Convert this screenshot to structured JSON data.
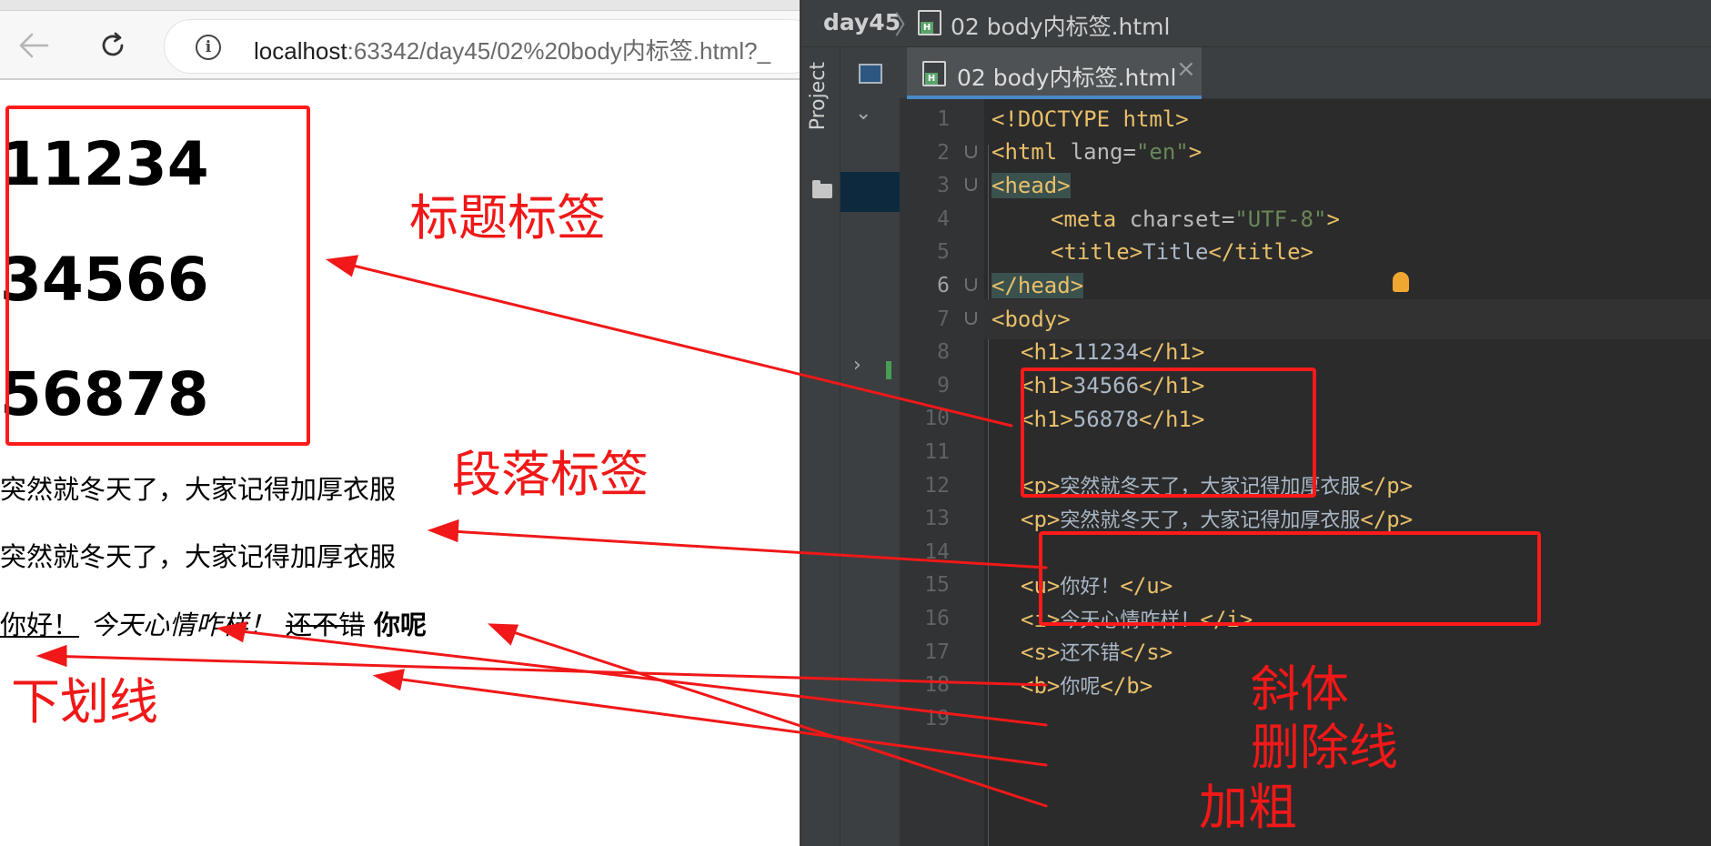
{
  "browser": {
    "url_host": "localhost",
    "url_path": ":63342/day45/02%20body内标签.html?_",
    "content": {
      "headings": [
        "11234",
        "34566",
        "56878"
      ],
      "paragraphs": [
        "突然就冬天了，大家记得加厚衣服",
        "突然就冬天了，大家记得加厚衣服"
      ],
      "underline_text": "你好！",
      "italic_text": "今天心情咋样！",
      "strike_text": "还不错",
      "bold_text": "你呢"
    }
  },
  "ide": {
    "breadcrumb": {
      "project": "day45",
      "separator": "〉",
      "file": "02 body内标签.html"
    },
    "side_tab": "Project",
    "editor_tab": {
      "label": "02 body内标签.html",
      "close": "×"
    },
    "line_numbers": [
      "1",
      "2",
      "3",
      "4",
      "5",
      "6",
      "7",
      "8",
      "9",
      "10",
      "11",
      "12",
      "13",
      "14",
      "15",
      "16",
      "17",
      "18",
      "19"
    ],
    "code": {
      "l1": "<!DOCTYPE html>",
      "l2": {
        "open": "<html ",
        "attr": "lang=",
        "val": "\"en\"",
        "close": ">"
      },
      "l3": "<head>",
      "l4": {
        "open": "<meta ",
        "attr": "charset=",
        "val": "\"UTF-8\"",
        "close": ">"
      },
      "l5": {
        "open": "<title>",
        "text": "Title",
        "close": "</title>"
      },
      "l6": "</head>",
      "l7": "<body>",
      "l8": {
        "open": "<h1>",
        "text": "11234",
        "close": "</h1>"
      },
      "l9": {
        "open": "<h1>",
        "text": "34566",
        "close": "</h1>"
      },
      "l10": {
        "open": "<h1>",
        "text": "56878",
        "close": "</h1>"
      },
      "l12": {
        "open": "<p>",
        "text": "突然就冬天了，大家记得加厚衣服",
        "close": "</p>"
      },
      "l13": {
        "open": "<p>",
        "text": "突然就冬天了，大家记得加厚衣服",
        "close": "</p>"
      },
      "l15": {
        "open": "<u>",
        "text": "你好！",
        "close": "</u>"
      },
      "l16": {
        "open": "<i>",
        "text": "今天心情咋样！",
        "close": "</i>"
      },
      "l17": {
        "open": "<s>",
        "text": "还不错",
        "close": "</s>"
      },
      "l18": {
        "open": "<b>",
        "text": "你呢",
        "close": "</b>"
      }
    }
  },
  "annotations": {
    "heading_label": "标题标签",
    "paragraph_label": "段落标签",
    "underline_label": "下划线",
    "italic_label": "斜体",
    "strike_label": "删除线",
    "bold_label": "加粗"
  },
  "colors": {
    "annotation_red": "#ff1a1a",
    "ide_background": "#2b2b2b",
    "tag_color": "#e8bf6a",
    "string_color": "#6a8759"
  }
}
